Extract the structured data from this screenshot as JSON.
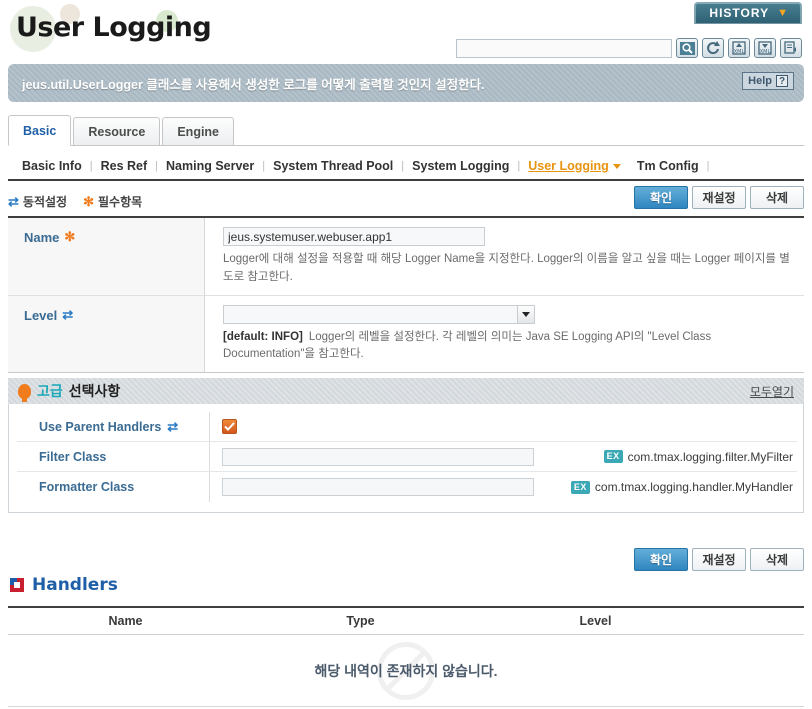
{
  "header": {
    "history_label": "HISTORY",
    "history_caret": "chevron-down-icon",
    "page_title": "User Logging"
  },
  "search": {
    "value": "",
    "placeholder": "",
    "buttons": [
      {
        "name": "search-icon",
        "title": "Search"
      },
      {
        "name": "refresh-icon",
        "title": "Refresh"
      },
      {
        "name": "xml-upload-icon",
        "title": "XML Upload"
      },
      {
        "name": "xml-download-icon",
        "title": "XML Download"
      },
      {
        "name": "save-export-icon",
        "title": "Save"
      }
    ]
  },
  "banner": {
    "description": "jeus.util.UserLogger 클래스를 사용해서 생성한 로그를 어떻게 출력할 것인지 설정한다.",
    "help_label": "Help",
    "help_mark": "?"
  },
  "tabs": [
    {
      "label": "Basic",
      "active": true
    },
    {
      "label": "Resource",
      "active": false
    },
    {
      "label": "Engine",
      "active": false
    }
  ],
  "subnav": [
    {
      "label": "Basic Info",
      "active": false
    },
    {
      "label": "Res Ref",
      "active": false
    },
    {
      "label": "Naming Server",
      "active": false
    },
    {
      "label": "System Thread Pool",
      "active": false
    },
    {
      "label": "System Logging",
      "active": false
    },
    {
      "label": "User Logging",
      "active": true
    },
    {
      "label": "Tm Config",
      "active": false
    }
  ],
  "legend": {
    "dynamic_label": "동적설정",
    "dynamic_icon": "refresh-icon",
    "required_label": "필수항목",
    "required_icon": "asterisk-icon"
  },
  "actions": {
    "confirm": "확인",
    "reset": "재설정",
    "delete": "삭제"
  },
  "form": {
    "rows": [
      {
        "label": "Name",
        "required_marker": "✻",
        "dynamic_marker": "",
        "value": "jeus.systemuser.webuser.app1",
        "hint_default": "",
        "hint": "Logger에 대해 설정을 적용할 때 해당 Logger Name을 지정한다. Logger의 이름을 알고 싶을 때는 Logger 페이지를 별도로 참고한다."
      },
      {
        "label": "Level",
        "required_marker": "",
        "dynamic_marker": "⟳",
        "value": "",
        "hint_default": "[default: INFO]",
        "hint": "Logger의 레벨을 설정한다. 각 레벨의 의미는 Java SE Logging API의 \"Level Class Documentation\"을 참고한다."
      }
    ]
  },
  "advanced": {
    "icon": "lightbulb-icon",
    "title_highlight": "고급",
    "title_rest": "선택사항",
    "open_all": "모두열기",
    "rows": [
      {
        "label": "Use Parent Handlers",
        "dynamic_marker": "⟳",
        "type": "checkbox",
        "checked": true,
        "value": "",
        "example_badge": "",
        "example_text": ""
      },
      {
        "label": "Filter Class",
        "dynamic_marker": "",
        "type": "text",
        "checked": false,
        "value": "",
        "example_badge": "EX",
        "example_text": "com.tmax.logging.filter.MyFilter"
      },
      {
        "label": "Formatter Class",
        "dynamic_marker": "",
        "type": "text",
        "checked": false,
        "value": "",
        "example_badge": "EX",
        "example_text": "com.tmax.logging.handler.MyHandler"
      }
    ]
  },
  "handlers": {
    "icon": "tmax-square-icon",
    "title": "Handlers",
    "columns": [
      "Name",
      "Type",
      "Level"
    ],
    "empty_message": "해당 내역이 존재하지 않습니다."
  }
}
